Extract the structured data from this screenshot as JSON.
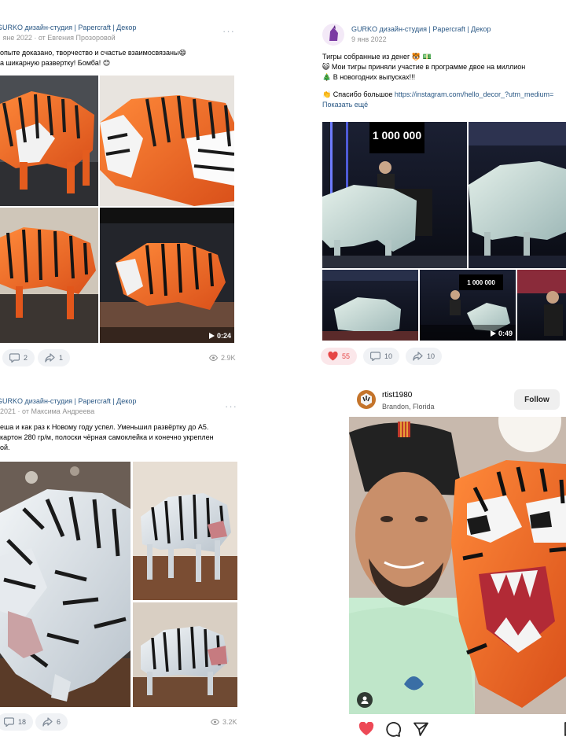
{
  "post1": {
    "group_name": "GURKO дизайн-студия | Papercraft | Декор",
    "meta": "· яне 2022 · от Евгения Прозоровой",
    "text_lines": [
      "опыте доказано, творчество и счастье взаимосвязаны😄",
      "а шикарную развертку! Бомба! 😊"
    ],
    "video_duration": "0:24",
    "comments": "2",
    "shares": "1",
    "views": "2.9K"
  },
  "post2": {
    "group_name": "GURKO дизайн-студия | Papercraft | Декор",
    "date": "9 янв 2022",
    "text_lines": [
      "Тигры собранные из денег 🐯 💵",
      "😺 Мои тигры приняли участие в программе двое на миллион",
      "🎄 В новогодних выпусках!!!"
    ],
    "thanks_text": "👏 Спасибо большое ",
    "link_text": "https://instagram.com/hello_decor_?utm_medium=",
    "show_more": "Показать ещё",
    "tv_score": "1 000 000",
    "tv_score_small": "1 000 000",
    "video_duration": "0:49",
    "likes": "55",
    "comments": "10",
    "shares": "10"
  },
  "post3": {
    "group_name": "GURKO дизайн-студия | Papercraft | Декор",
    "meta": "2021 · от Максима Андреева",
    "text_lines": [
      "еша и как раз к Новому году успел. Уменьшил развёртку до А5.",
      "картон 280 гр/м, полоски чёрная самоклейка и конечно укреплен",
      "ой."
    ],
    "comments": "18",
    "shares": "6",
    "views": "3.2K"
  },
  "post4": {
    "username": "rtist1980",
    "location": "Brandon, Florida",
    "follow_label": "Follow"
  },
  "colors": {
    "vk_link": "#2a5885",
    "tiger_orange": "#f06a1f",
    "like_red": "#e64646",
    "ig_heart": "#ed4956"
  },
  "icons": [
    "more-icon",
    "play-icon",
    "comment-icon",
    "share-icon",
    "eye-icon",
    "heart-icon",
    "ig-comment-icon",
    "ig-send-icon",
    "ig-save-icon",
    "person-icon"
  ]
}
